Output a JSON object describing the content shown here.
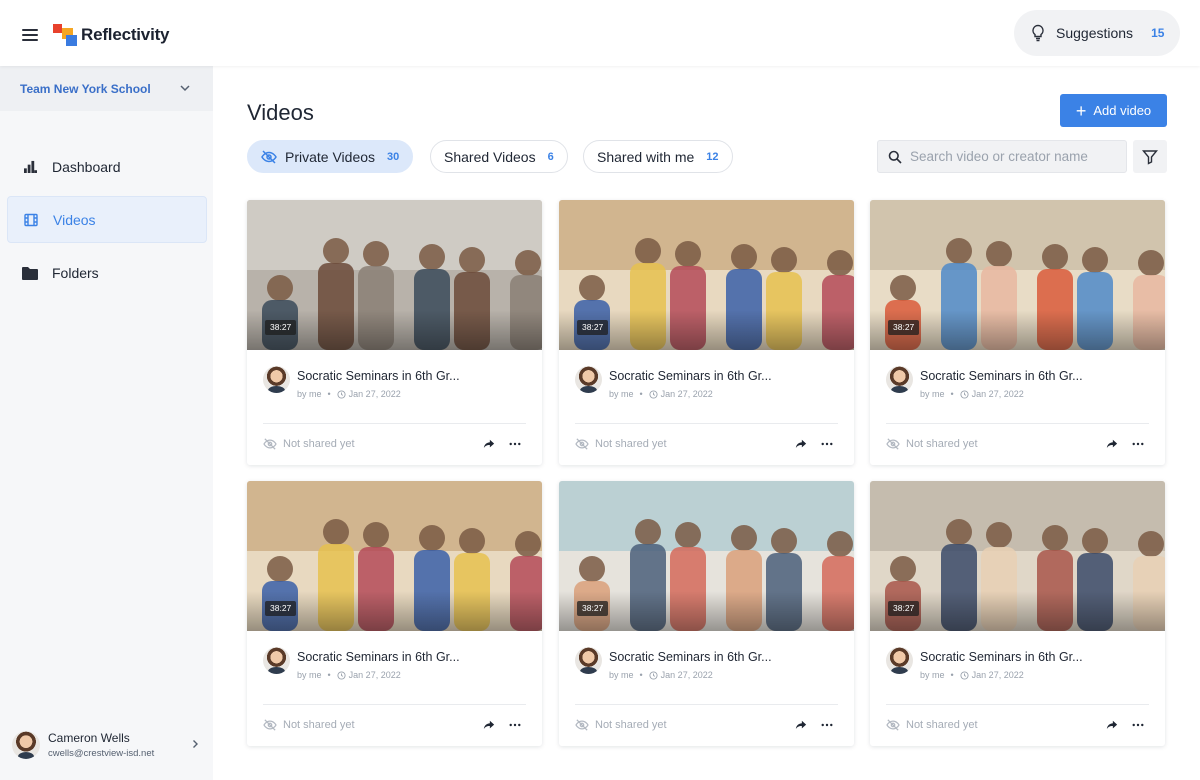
{
  "app": {
    "name": "Reflectivity"
  },
  "topbar": {
    "suggestions_label": "Suggestions",
    "suggestions_count": "15"
  },
  "sidebar": {
    "team": "Team New York School",
    "items": [
      {
        "label": "Dashboard",
        "icon": "chart-icon"
      },
      {
        "label": "Videos",
        "icon": "film-icon",
        "active": true
      },
      {
        "label": "Folders",
        "icon": "folder-icon"
      }
    ],
    "user": {
      "name": "Cameron Wells",
      "email": "cwells@crestview-isd.net"
    }
  },
  "main": {
    "title": "Videos",
    "add_label": "Add video",
    "tabs": [
      {
        "label": "Private Videos",
        "count": "30",
        "active": true
      },
      {
        "label": "Shared Videos",
        "count": "6"
      },
      {
        "label": "Shared with me",
        "count": "12"
      }
    ],
    "search_placeholder": "Search video or creator name",
    "videos": [
      {
        "duration": "38:27",
        "title": "Socratic Seminars in 6th Gr...",
        "author": "by me",
        "date": "Jan 27, 2022",
        "share": "Not shared yet"
      },
      {
        "duration": "38:27",
        "title": "Socratic Seminars in 6th Gr...",
        "author": "by me",
        "date": "Jan 27, 2022",
        "share": "Not shared yet"
      },
      {
        "duration": "38:27",
        "title": "Socratic Seminars in 6th Gr...",
        "author": "by me",
        "date": "Jan 27, 2022",
        "share": "Not shared yet"
      },
      {
        "duration": "38:27",
        "title": "Socratic Seminars in 6th Gr...",
        "author": "by me",
        "date": "Jan 27, 2022",
        "share": "Not shared yet"
      },
      {
        "duration": "38:27",
        "title": "Socratic Seminars in 6th Gr...",
        "author": "by me",
        "date": "Jan 27, 2022",
        "share": "Not shared yet"
      },
      {
        "duration": "38:27",
        "title": "Socratic Seminars in 6th Gr...",
        "author": "by me",
        "date": "Jan 27, 2022",
        "share": "Not shared yet"
      }
    ]
  },
  "colors": {
    "accent": "#3b82e6",
    "sidebar_bg": "#f6f7f9",
    "active_nav": "#e9f0fb"
  }
}
